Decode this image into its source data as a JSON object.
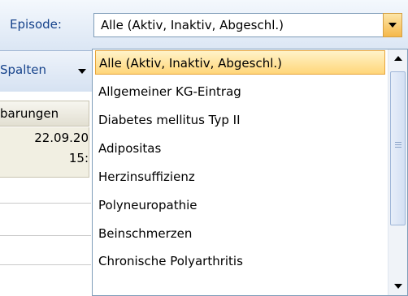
{
  "toolbar": {
    "episode_label": "Episode:",
    "episode_value": "Alle (Aktiv, Inaktiv, Abgeschl.)"
  },
  "toolbar2": {
    "spalten_label": "Spalten"
  },
  "table": {
    "column_header": "barungen",
    "cell_date": "22.09.20",
    "cell_time": "15:"
  },
  "dropdown": {
    "items": [
      "Alle (Aktiv, Inaktiv, Abgeschl.)",
      "Allgemeiner KG-Eintrag",
      "Diabetes mellitus Typ II",
      "Adipositas",
      "Herzinsuffizienz",
      "Polyneuropathie",
      "Beinschmerzen",
      "Chronische Polyarthritis"
    ],
    "selected_index": 0
  },
  "colors": {
    "accent_text": "#15428b",
    "selection": "#ffd67a",
    "selection_border": "#e8a53b"
  }
}
